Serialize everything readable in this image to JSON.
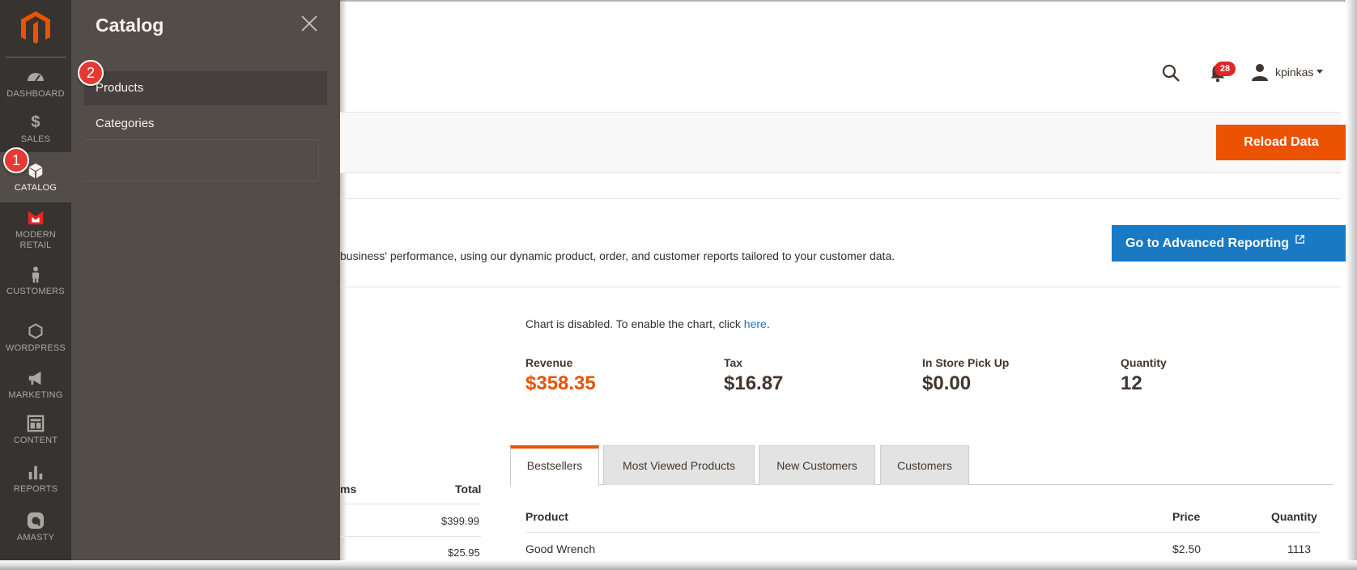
{
  "colors": {
    "nav_bg": "#373330",
    "flyout_bg": "#524d49",
    "accent_orange": "#eb5202",
    "accent_blue": "#1979c3",
    "badge_red": "#e22626",
    "marker_red": "#e53935"
  },
  "sidebar": {
    "logo": "magento-logo-icon",
    "items": [
      {
        "label": "DASHBOARD",
        "icon": "gauge-icon"
      },
      {
        "label": "SALES",
        "icon": "dollar-icon"
      },
      {
        "label": "CATALOG",
        "icon": "cube-icon",
        "active": true
      },
      {
        "label": "MODERN RETAIL",
        "line1": "MODERN",
        "line2": "RETAIL",
        "icon": "modern-retail-logo-icon"
      },
      {
        "label": "CUSTOMERS",
        "icon": "person-icon"
      },
      {
        "label": "WORDPRESS",
        "icon": "hexagon-icon"
      },
      {
        "label": "MARKETING",
        "icon": "megaphone-icon"
      },
      {
        "label": "CONTENT",
        "icon": "layout-icon"
      },
      {
        "label": "REPORTS",
        "icon": "bar-chart-icon"
      },
      {
        "label": "AMASTY",
        "icon": "amasty-logo-icon"
      }
    ]
  },
  "flyout": {
    "title": "Catalog",
    "items": [
      "Products",
      "Categories"
    ]
  },
  "markers": {
    "one": "1",
    "two": "2"
  },
  "header": {
    "notification_count": "28",
    "username": "kpinkas"
  },
  "actions": {
    "reload": "Reload Data",
    "advanced_reporting": "Go to Advanced Reporting"
  },
  "intro": {
    "text": "business' performance, using our dynamic product, order, and customer reports tailored to your customer data."
  },
  "chart_note": {
    "text": "Chart is disabled. To enable the chart, click ",
    "link": "here",
    "end": "."
  },
  "totals": [
    {
      "label": "Revenue",
      "value": "$358.35"
    },
    {
      "label": "Tax",
      "value": "$16.87"
    },
    {
      "label": "In Store Pick Up",
      "value": "$0.00"
    },
    {
      "label": "Quantity",
      "value": "12"
    }
  ],
  "left_table": {
    "col_partial": "ms",
    "col_total": "Total",
    "rows": [
      "$399.99",
      "$25.95"
    ]
  },
  "tabs": [
    "Bestsellers",
    "Most Viewed Products",
    "New Customers",
    "Customers"
  ],
  "bestsellers": {
    "headers": {
      "product": "Product",
      "price": "Price",
      "quantity": "Quantity"
    },
    "rows": [
      {
        "product": "Good Wrench",
        "price": "$2.50",
        "quantity": "1113"
      }
    ]
  }
}
